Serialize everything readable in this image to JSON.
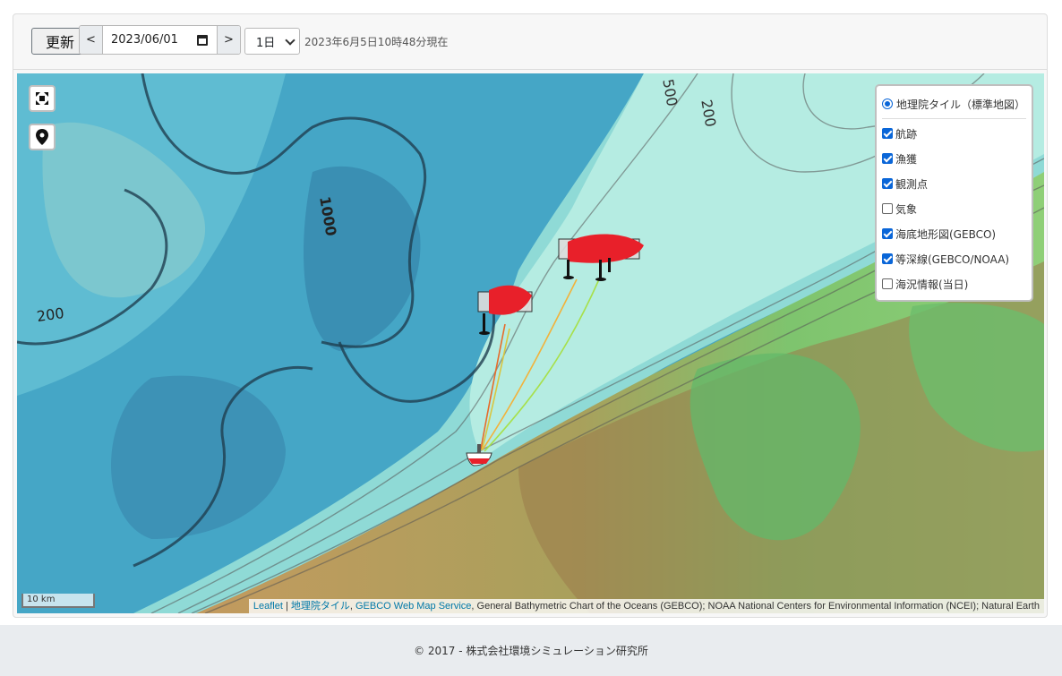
{
  "toolbar": {
    "update_label": "更新",
    "prev_label": "<",
    "next_label": ">",
    "date_value": "2023/06/01",
    "period_value": "1日",
    "status": "2023年6月5日10時48分現在"
  },
  "map": {
    "contour_labels": [
      "500",
      "200",
      "1000",
      "200"
    ],
    "scale_label": "10 km",
    "attribution": {
      "leaflet": "Leaflet",
      "sep": " | ",
      "gsi": "地理院タイル",
      "comma": ", ",
      "gebco_wms": "GEBCO Web Map Service",
      "rest": ", General Bathymetric Chart of the Oceans (GEBCO); NOAA National Centers for Environmental Information (NCEI); Natural Earth"
    }
  },
  "layers": {
    "base": {
      "label": "地理院タイル（標準地図）",
      "selected": true
    },
    "overlays": [
      {
        "label": "航跡",
        "checked": true
      },
      {
        "label": "漁獲",
        "checked": true
      },
      {
        "label": "観測点",
        "checked": true
      },
      {
        "label": "気象",
        "checked": false
      },
      {
        "label": "海底地形図(GEBCO)",
        "checked": true
      },
      {
        "label": "等深線(GEBCO/NOAA)",
        "checked": true
      },
      {
        "label": "海況情報(当日)",
        "checked": false
      }
    ]
  },
  "footer": {
    "copyright": "© 2017 - 株式会社環境シミュレーション研究所"
  },
  "colors": {
    "deep_sea": "#3f9ec0",
    "shelf": "#9fe3dc",
    "land_green": "#6cc07a",
    "land_brown": "#b8905a",
    "flag_red": "#e8202a",
    "checkbox_blue": "#0a66d8"
  }
}
